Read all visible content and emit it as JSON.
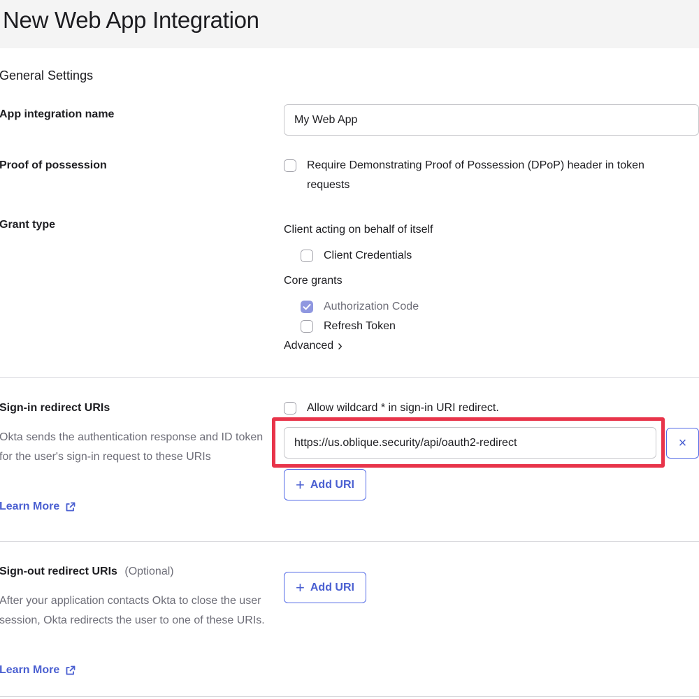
{
  "page": {
    "title": "New Web App Integration"
  },
  "general": {
    "section_title": "General Settings",
    "app_name_label": "App integration name",
    "app_name_value": "My Web App",
    "pop_label": "Proof of possession",
    "pop_checkbox_line1": "Require Demonstrating Proof of Possession (DPoP) header in token",
    "pop_checkbox_line2": "requests",
    "grant_label": "Grant type",
    "client_acting": "Client acting on behalf of itself",
    "client_credentials": "Client Credentials",
    "core_grants": "Core grants",
    "authorization_code": "Authorization Code",
    "refresh_token": "Refresh Token",
    "advanced": "Advanced",
    "advanced_chevron": "›"
  },
  "signin": {
    "label": "Sign-in redirect URIs",
    "wildcard_label": "Allow wildcard * in sign-in URI redirect.",
    "description": "Okta sends the authentication response and ID token for the user's sign-in request to these URIs",
    "learn_more": "Learn More",
    "uri_value": "https://us.oblique.security/api/oauth2-redirect",
    "remove_glyph": "×",
    "add_uri_label": "Add URI",
    "plus_glyph": "+"
  },
  "signout": {
    "label": "Sign-out redirect URIs",
    "optional": "(Optional)",
    "description": "After your application contacts Okta to close the user session, Okta redirects the user to one of these URIs.",
    "learn_more": "Learn More",
    "add_uri_label": "Add URI",
    "plus_glyph": "+"
  },
  "icons": {
    "external_link": "external-link-icon",
    "check": "check-icon",
    "plus": "plus-icon",
    "close": "close-icon",
    "chevron": "chevron-right-icon"
  },
  "colors": {
    "accent": "#4a5fd1",
    "highlight": "#e8344a",
    "checked": "#8f97e0"
  },
  "states": {
    "pop_checked": false,
    "client_credentials_checked": false,
    "authorization_code_checked": true,
    "refresh_token_checked": false,
    "wildcard_checked": false
  }
}
